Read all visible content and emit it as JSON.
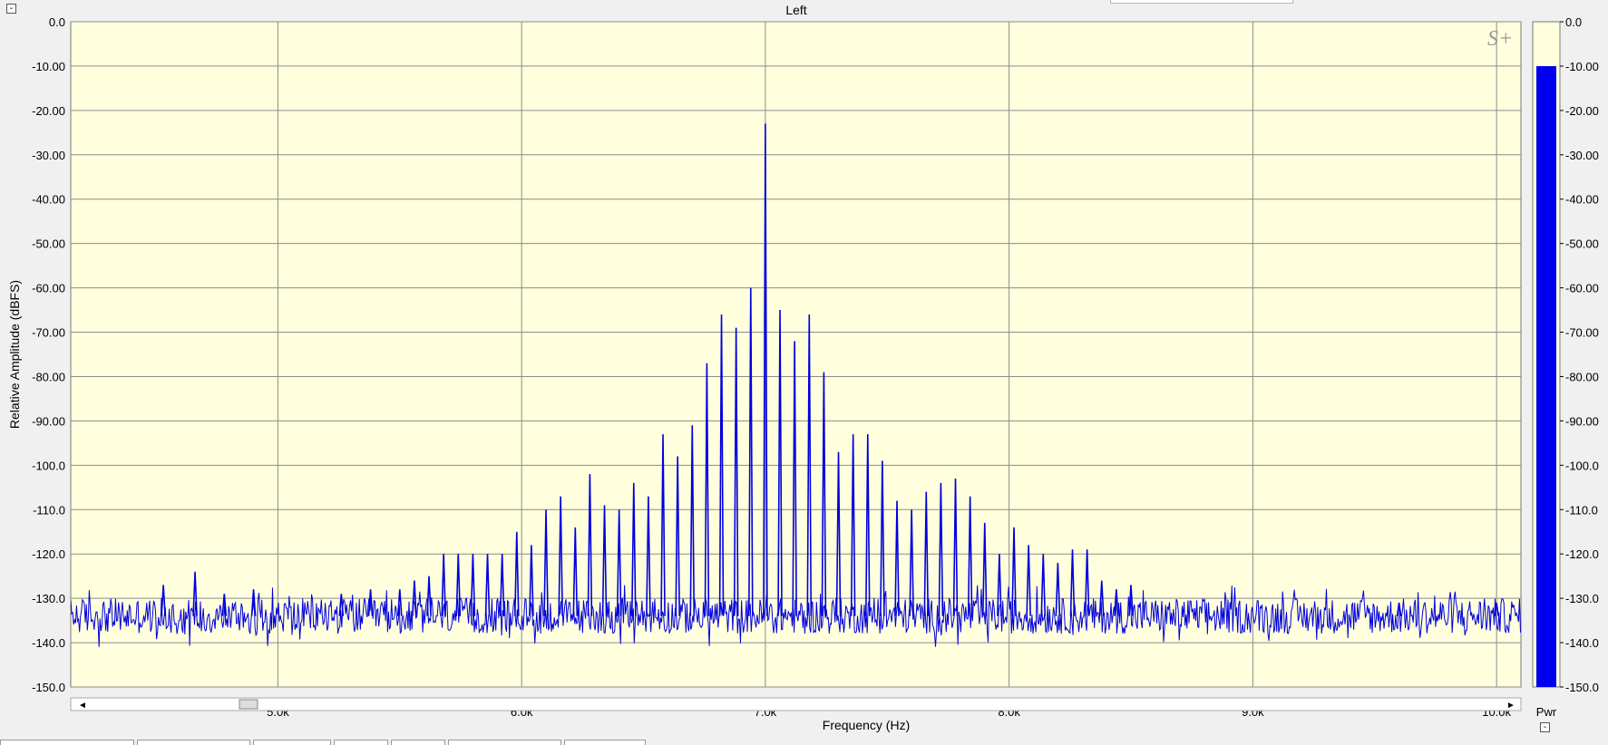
{
  "window": {
    "collapse_glyph": "-"
  },
  "meter": {
    "label": "Pwr",
    "level_db": -10,
    "ylim": [
      -150,
      0
    ],
    "fill_color": "#0000ee",
    "tick_labels": [
      "0.0",
      "-10.00",
      "-20.00",
      "-30.00",
      "-40.00",
      "-50.00",
      "-60.00",
      "-70.00",
      "-80.00",
      "-90.00",
      "-100.0",
      "-110.0",
      "-120.0",
      "-130.0",
      "-140.0",
      "-150.0"
    ]
  },
  "colors": {
    "plot_bg": "#ffffdd",
    "trace": "#0000dd",
    "grid": "#8c8c8c"
  },
  "logo_glyph": "S+",
  "chart_data": {
    "type": "line",
    "title": "Left",
    "xlabel": "Frequency (Hz)",
    "ylabel": "Relative Amplitude (dBFS)",
    "xlim": [
      4150,
      10100
    ],
    "ylim": [
      -150,
      0
    ],
    "x_ticks": [
      5000,
      6000,
      7000,
      8000,
      9000,
      10000
    ],
    "x_tick_labels": [
      "5.0k",
      "6.0k",
      "7.0k",
      "8.0k",
      "9.0k",
      "10.0k"
    ],
    "y_ticks": [
      0,
      -10,
      -20,
      -30,
      -40,
      -50,
      -60,
      -70,
      -80,
      -90,
      -100,
      -110,
      -120,
      -130,
      -140,
      -150
    ],
    "y_tick_labels": [
      "0.0",
      "-10.00",
      "-20.00",
      "-30.00",
      "-40.00",
      "-50.00",
      "-60.00",
      "-70.00",
      "-80.00",
      "-90.00",
      "-100.0",
      "-110.0",
      "-120.0",
      "-130.0",
      "-140.0",
      "-150.0"
    ],
    "grid": true,
    "series": [
      {
        "noise_floor_db": -134,
        "noise_spread_db": 5,
        "peaks": [
          {
            "x": 7000,
            "y": -23
          },
          {
            "x": 6940,
            "y": -60
          },
          {
            "x": 7060,
            "y": -65
          },
          {
            "x": 6880,
            "y": -69
          },
          {
            "x": 7120,
            "y": -72
          },
          {
            "x": 6820,
            "y": -66
          },
          {
            "x": 7180,
            "y": -66
          },
          {
            "x": 6760,
            "y": -77
          },
          {
            "x": 7240,
            "y": -79
          },
          {
            "x": 6700,
            "y": -91
          },
          {
            "x": 7300,
            "y": -97
          },
          {
            "x": 6640,
            "y": -98
          },
          {
            "x": 7360,
            "y": -93
          },
          {
            "x": 6580,
            "y": -93
          },
          {
            "x": 7420,
            "y": -93
          },
          {
            "x": 6520,
            "y": -107
          },
          {
            "x": 7480,
            "y": -99
          },
          {
            "x": 6460,
            "y": -104
          },
          {
            "x": 7540,
            "y": -108
          },
          {
            "x": 6400,
            "y": -110
          },
          {
            "x": 7600,
            "y": -110
          },
          {
            "x": 6340,
            "y": -109
          },
          {
            "x": 7660,
            "y": -106
          },
          {
            "x": 6280,
            "y": -102
          },
          {
            "x": 7720,
            "y": -104
          },
          {
            "x": 6220,
            "y": -114
          },
          {
            "x": 7780,
            "y": -103
          },
          {
            "x": 6160,
            "y": -107
          },
          {
            "x": 7840,
            "y": -107
          },
          {
            "x": 6100,
            "y": -110
          },
          {
            "x": 7900,
            "y": -113
          },
          {
            "x": 6040,
            "y": -118
          },
          {
            "x": 7960,
            "y": -120
          },
          {
            "x": 5980,
            "y": -115
          },
          {
            "x": 8020,
            "y": -114
          },
          {
            "x": 5920,
            "y": -120
          },
          {
            "x": 8080,
            "y": -118
          },
          {
            "x": 5860,
            "y": -120
          },
          {
            "x": 8140,
            "y": -120
          },
          {
            "x": 5800,
            "y": -120
          },
          {
            "x": 8200,
            "y": -122
          },
          {
            "x": 5740,
            "y": -120
          },
          {
            "x": 8260,
            "y": -119
          },
          {
            "x": 5680,
            "y": -120
          },
          {
            "x": 8320,
            "y": -119
          },
          {
            "x": 5620,
            "y": -125
          },
          {
            "x": 8380,
            "y": -126
          },
          {
            "x": 5560,
            "y": -126
          },
          {
            "x": 8440,
            "y": -128
          },
          {
            "x": 5500,
            "y": -128
          },
          {
            "x": 8500,
            "y": -127
          },
          {
            "x": 4660,
            "y": -124
          },
          {
            "x": 4530,
            "y": -127
          },
          {
            "x": 5380,
            "y": -128
          },
          {
            "x": 5260,
            "y": -129
          },
          {
            "x": 4900,
            "y": -128
          },
          {
            "x": 4780,
            "y": -129
          },
          {
            "x": 10000,
            "y": -131
          },
          {
            "x": 9600,
            "y": -131
          }
        ]
      }
    ]
  }
}
